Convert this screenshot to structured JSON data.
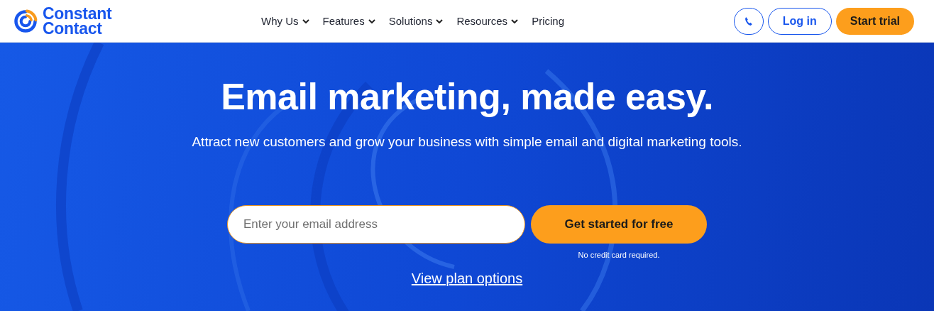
{
  "header": {
    "logo": {
      "lines": [
        "Constant",
        "Contact"
      ]
    },
    "nav": [
      {
        "label": "Why Us",
        "has_menu": true
      },
      {
        "label": "Features",
        "has_menu": true
      },
      {
        "label": "Solutions",
        "has_menu": true
      },
      {
        "label": "Resources",
        "has_menu": true
      },
      {
        "label": "Pricing",
        "has_menu": false
      }
    ],
    "actions": [
      {
        "kind": "phone"
      },
      {
        "kind": "outline",
        "label": "Log in"
      },
      {
        "kind": "primary",
        "label": "Start trial"
      }
    ]
  },
  "hero": {
    "title": "Email marketing, made easy.",
    "subtitle": "Attract new customers and grow your business with simple email and digital marketing tools.",
    "email_field": {
      "placeholder": "Enter your email address"
    },
    "cta": {
      "label": "Get started for free"
    },
    "cta_note": "No credit card required.",
    "link": "View plan options"
  }
}
